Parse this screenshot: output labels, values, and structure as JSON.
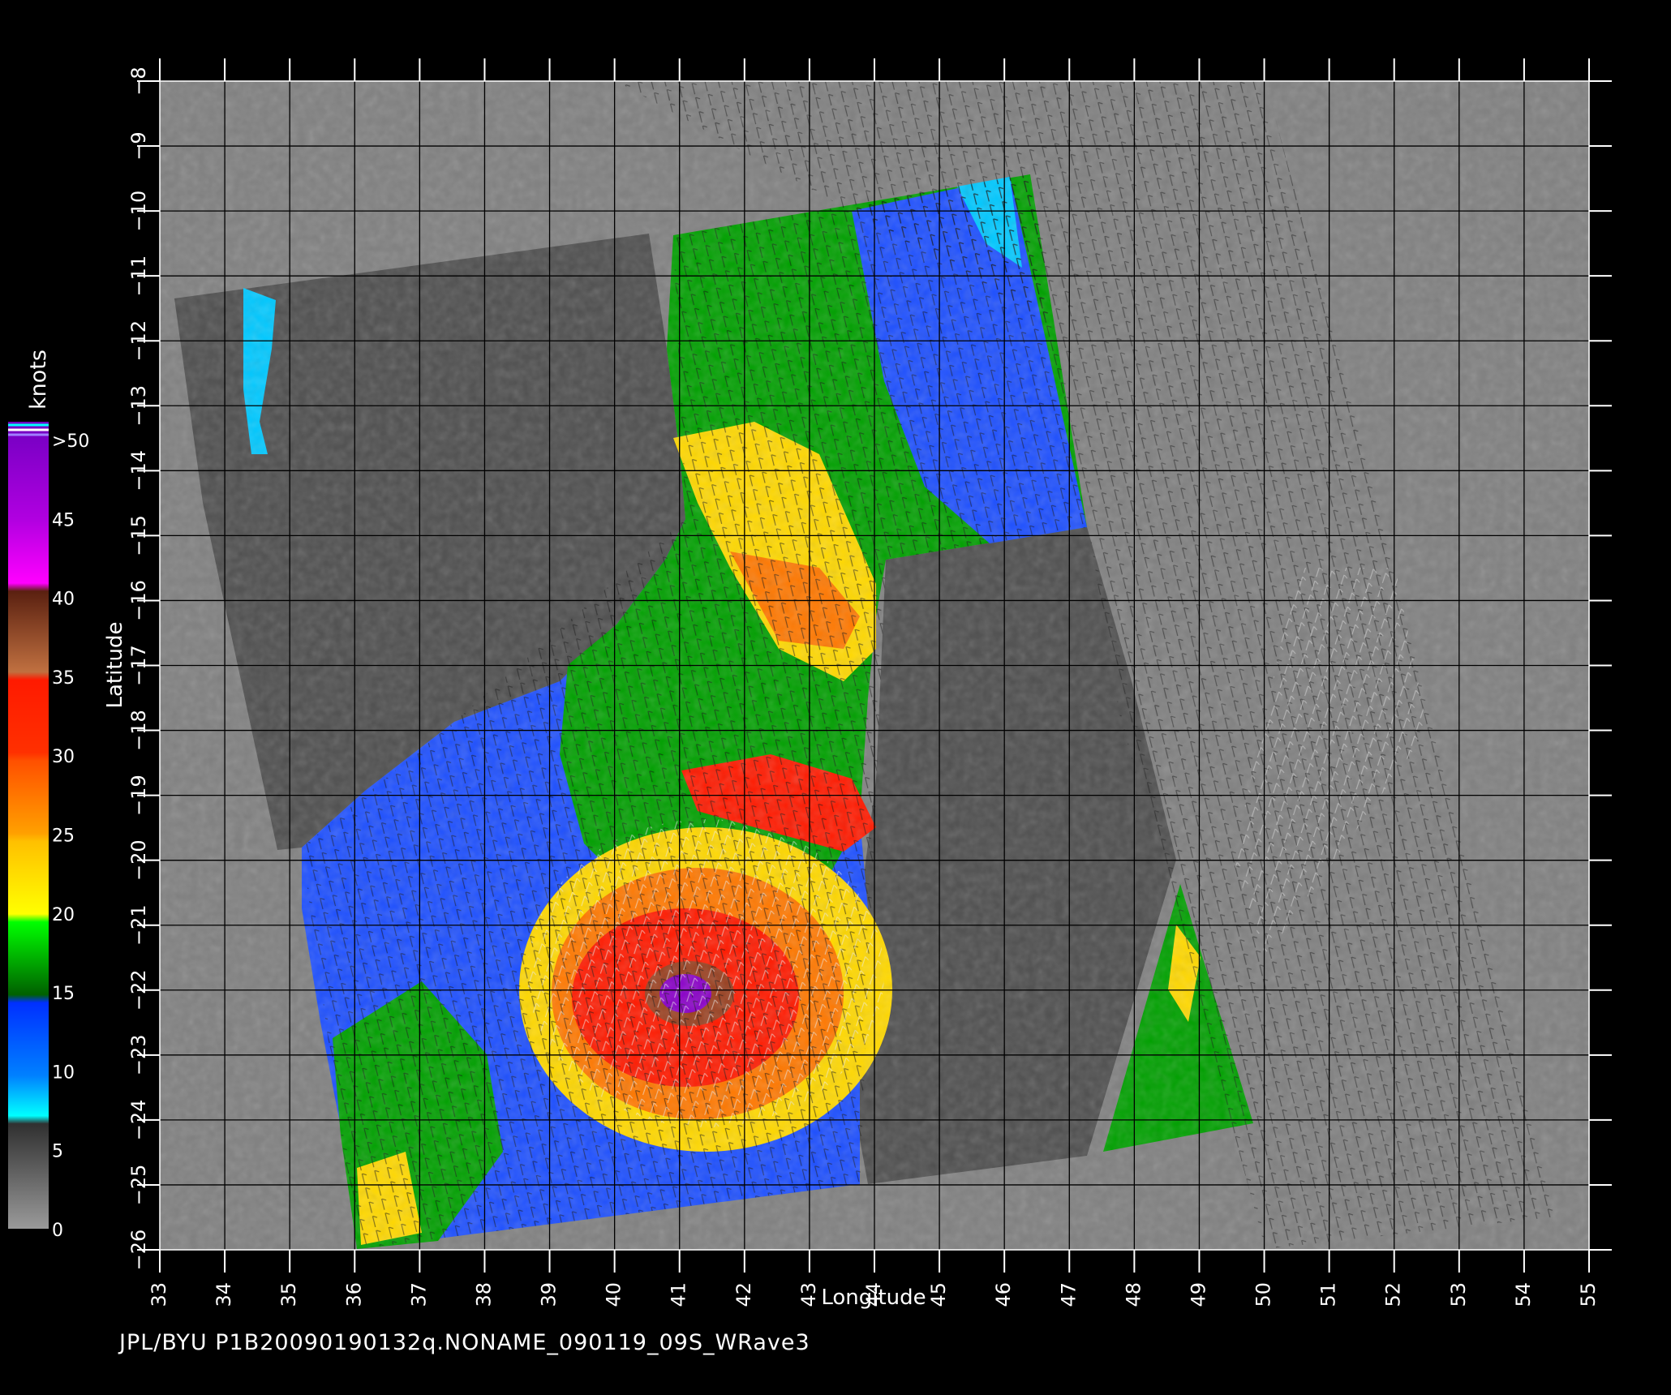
{
  "axes": {
    "xlabel": "Longitude",
    "ylabel": "Latitude",
    "x_ticks": [
      "33",
      "34",
      "35",
      "36",
      "37",
      "38",
      "39",
      "40",
      "41",
      "42",
      "43",
      "44",
      "45",
      "46",
      "47",
      "48",
      "49",
      "50",
      "51",
      "52",
      "53",
      "54",
      "55"
    ],
    "y_ticks": [
      "−8",
      "−9",
      "−10",
      "−11",
      "−12",
      "−13",
      "−14",
      "−15",
      "−16",
      "−17",
      "−18",
      "−19",
      "−20",
      "−21",
      "−22",
      "−23",
      "−24",
      "−25",
      "−26"
    ]
  },
  "legend": {
    "unit": "knots",
    "labels": [
      ">50",
      "45",
      "40",
      "35",
      "30",
      "25",
      "20",
      "15",
      "10",
      "5",
      "0"
    ]
  },
  "footer": "JPL/BYU  P1B20090190132q.NONAME_090119_09S_WRave3",
  "colors": {
    "background": "#000000",
    "no_data": "#808080",
    "land": "#4f4f4f",
    "wind_0_5": "#6b6b6b",
    "wind_5_10": "#00c8ff",
    "wind_10_15": "#1e50ff",
    "wind_15_20": "#00a000",
    "wind_20_25": "#ffd800",
    "wind_25_30": "#ff7800",
    "wind_30_35": "#ff1a00",
    "wind_35_40": "#9a4020",
    "wind_40_45": "#ff00ff",
    "wind_45_50": "#8a00c8",
    "wind_over_50": "#7000c0"
  }
}
